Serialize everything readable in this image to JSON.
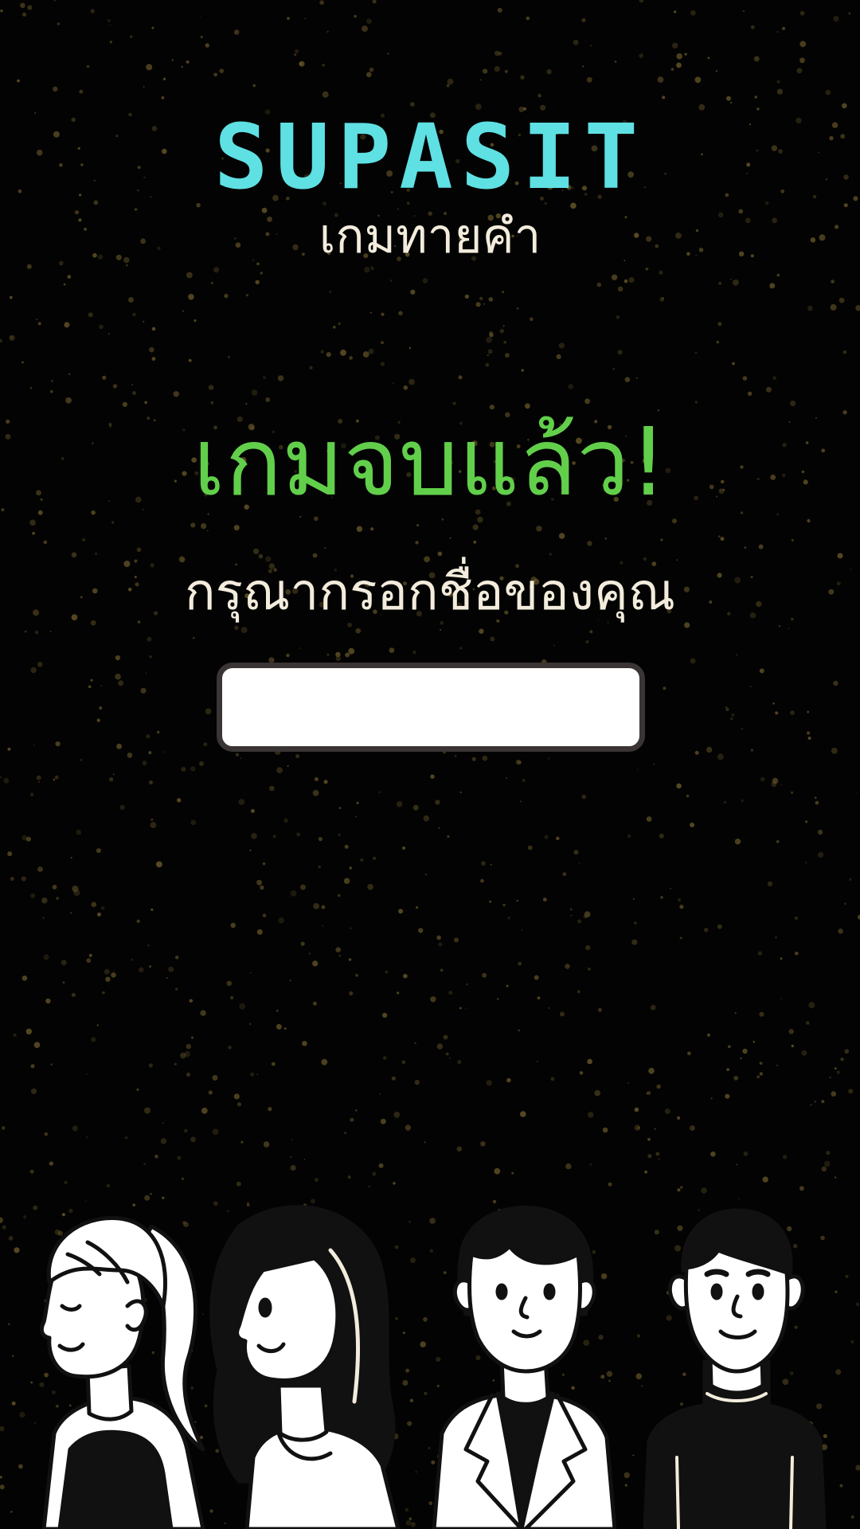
{
  "app": {
    "title": "SUPASIT",
    "subtitle": "เกมทายคำ"
  },
  "game_over": {
    "heading": "เกมจบแล้ว!",
    "prompt": "กรุณากรอกชื่อของคุณ",
    "name_input": {
      "value": "",
      "placeholder": ""
    }
  },
  "characters": [
    {
      "icon": "blonde-ponytail-woman-icon"
    },
    {
      "icon": "dark-haired-woman-icon"
    },
    {
      "icon": "woman-in-blazer-icon"
    },
    {
      "icon": "man-in-turtleneck-icon"
    }
  ],
  "colors": {
    "background": "#030303",
    "title": "#5fe0e3",
    "heading": "#62cf4b",
    "text": "#f3ecdc",
    "speckle": "#6b5a2a"
  }
}
